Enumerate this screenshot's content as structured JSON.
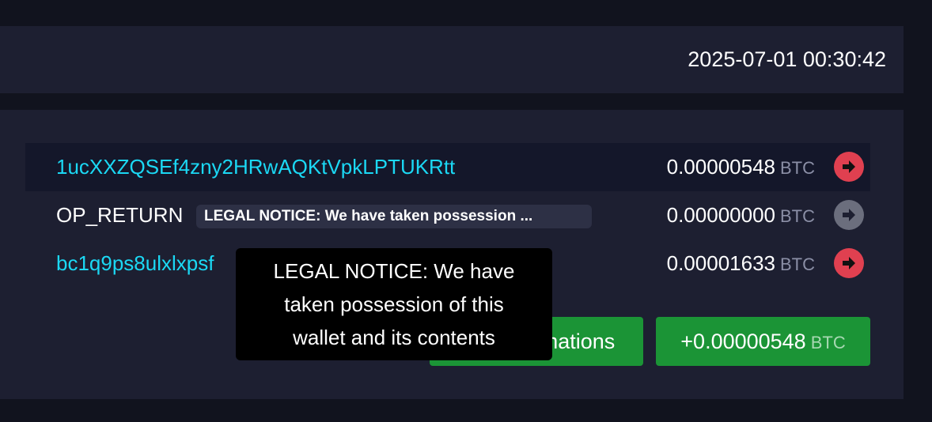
{
  "header": {
    "timestamp": "2025-07-01 00:30:42"
  },
  "outputs": [
    {
      "address": "1ucXXZQSEf4zny2HRwAQKtVpkLPTUKRtt",
      "amount": "0.00000548",
      "unit": "BTC",
      "status": "spent"
    },
    {
      "address": "OP_RETURN",
      "badge": "LEGAL NOTICE: We have taken possession ...",
      "amount": "0.00000000",
      "unit": "BTC",
      "status": "unspendable"
    },
    {
      "address": "bc1q9ps8ulxlxpsf",
      "amount": "0.00001633",
      "unit": "BTC",
      "status": "spent"
    }
  ],
  "footer": {
    "confirmations_visible": "rmations",
    "total_amount": "+0.00000548",
    "total_unit": "BTC"
  },
  "tooltip": {
    "lines": [
      "LEGAL NOTICE: We have",
      "taken possession of this",
      "wallet and its contents"
    ]
  },
  "colors": {
    "background": "#11131e",
    "card": "#1d1f31",
    "link": "#1bd8f4",
    "spent_arrow": "#e04050",
    "unspendable_arrow": "#6b6e7d",
    "success": "#1b9436"
  },
  "icons": {
    "arrow": "arrow-right-circle-icon"
  }
}
